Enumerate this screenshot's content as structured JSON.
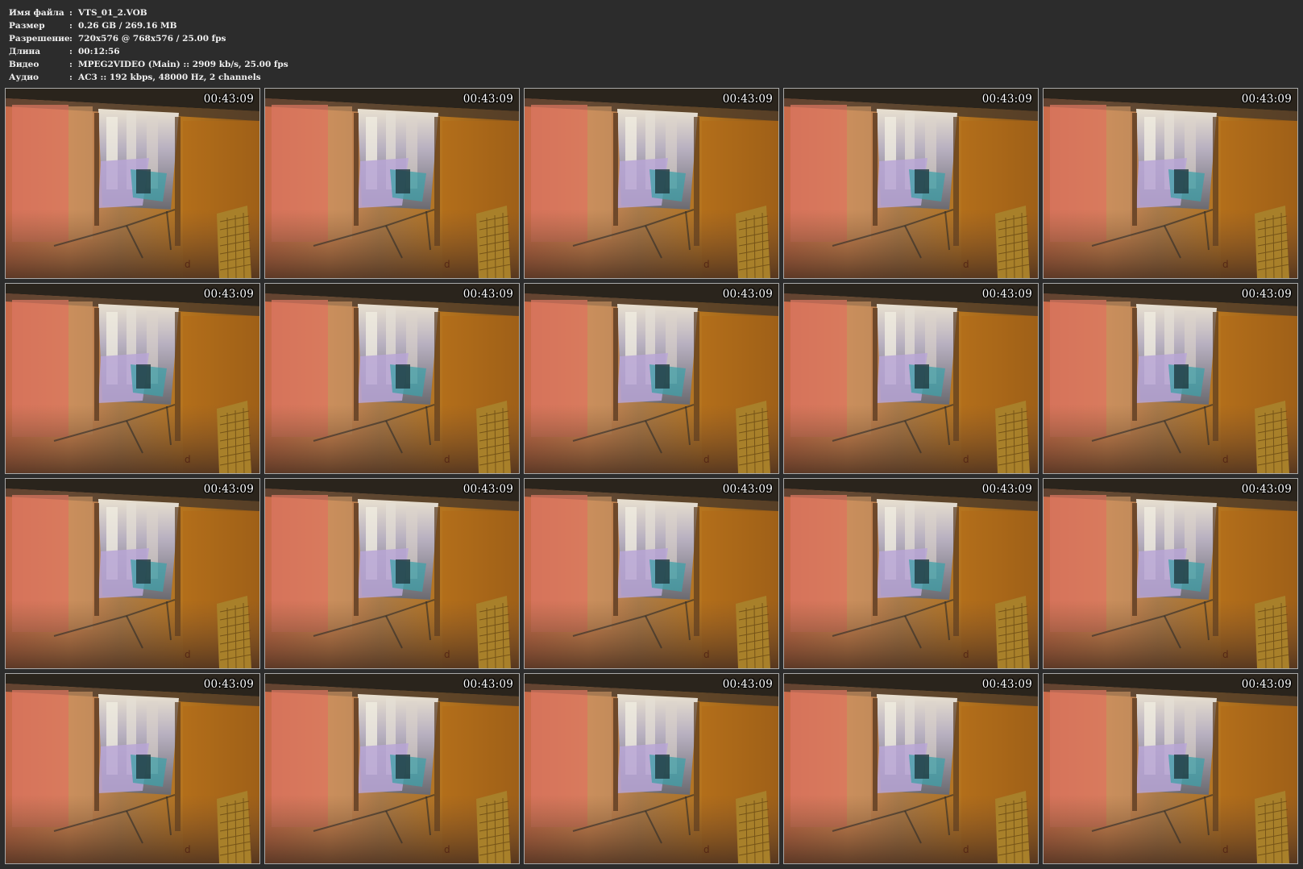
{
  "file_info": [
    {
      "label": "Имя файла",
      "value": "VTS_01_2.VOB"
    },
    {
      "label": "Размер",
      "value": "0.26 GB  / 269.16 MB"
    },
    {
      "label": "Разрешение",
      "value": "720x576 @ 768x576 / 25.00 fps"
    },
    {
      "label": "Длина",
      "value": "00:12:56"
    },
    {
      "label": "Видео",
      "value": "MPEG2VIDEO (Main) :: 2909 kb/s, 25.00 fps"
    },
    {
      "label": "Аудио",
      "value": "AC3 :: 192 kbps, 48000 Hz, 2 channels"
    }
  ],
  "separator": ":",
  "thumbnails": [
    {
      "timestamp": "00:43:09"
    },
    {
      "timestamp": "00:43:09"
    },
    {
      "timestamp": "00:43:09"
    },
    {
      "timestamp": "00:43:09"
    },
    {
      "timestamp": "00:43:09"
    },
    {
      "timestamp": "00:43:09"
    },
    {
      "timestamp": "00:43:09"
    },
    {
      "timestamp": "00:43:09"
    },
    {
      "timestamp": "00:43:09"
    },
    {
      "timestamp": "00:43:09"
    },
    {
      "timestamp": "00:43:09"
    },
    {
      "timestamp": "00:43:09"
    },
    {
      "timestamp": "00:43:09"
    },
    {
      "timestamp": "00:43:09"
    },
    {
      "timestamp": "00:43:09"
    },
    {
      "timestamp": "00:43:09"
    },
    {
      "timestamp": "00:43:09"
    },
    {
      "timestamp": "00:43:09"
    },
    {
      "timestamp": "00:43:09"
    },
    {
      "timestamp": "00:43:09"
    }
  ],
  "colors": {
    "background": "#2c2c2c",
    "thumb_border": "#a8a8a8",
    "text": "#f0f0f0"
  }
}
